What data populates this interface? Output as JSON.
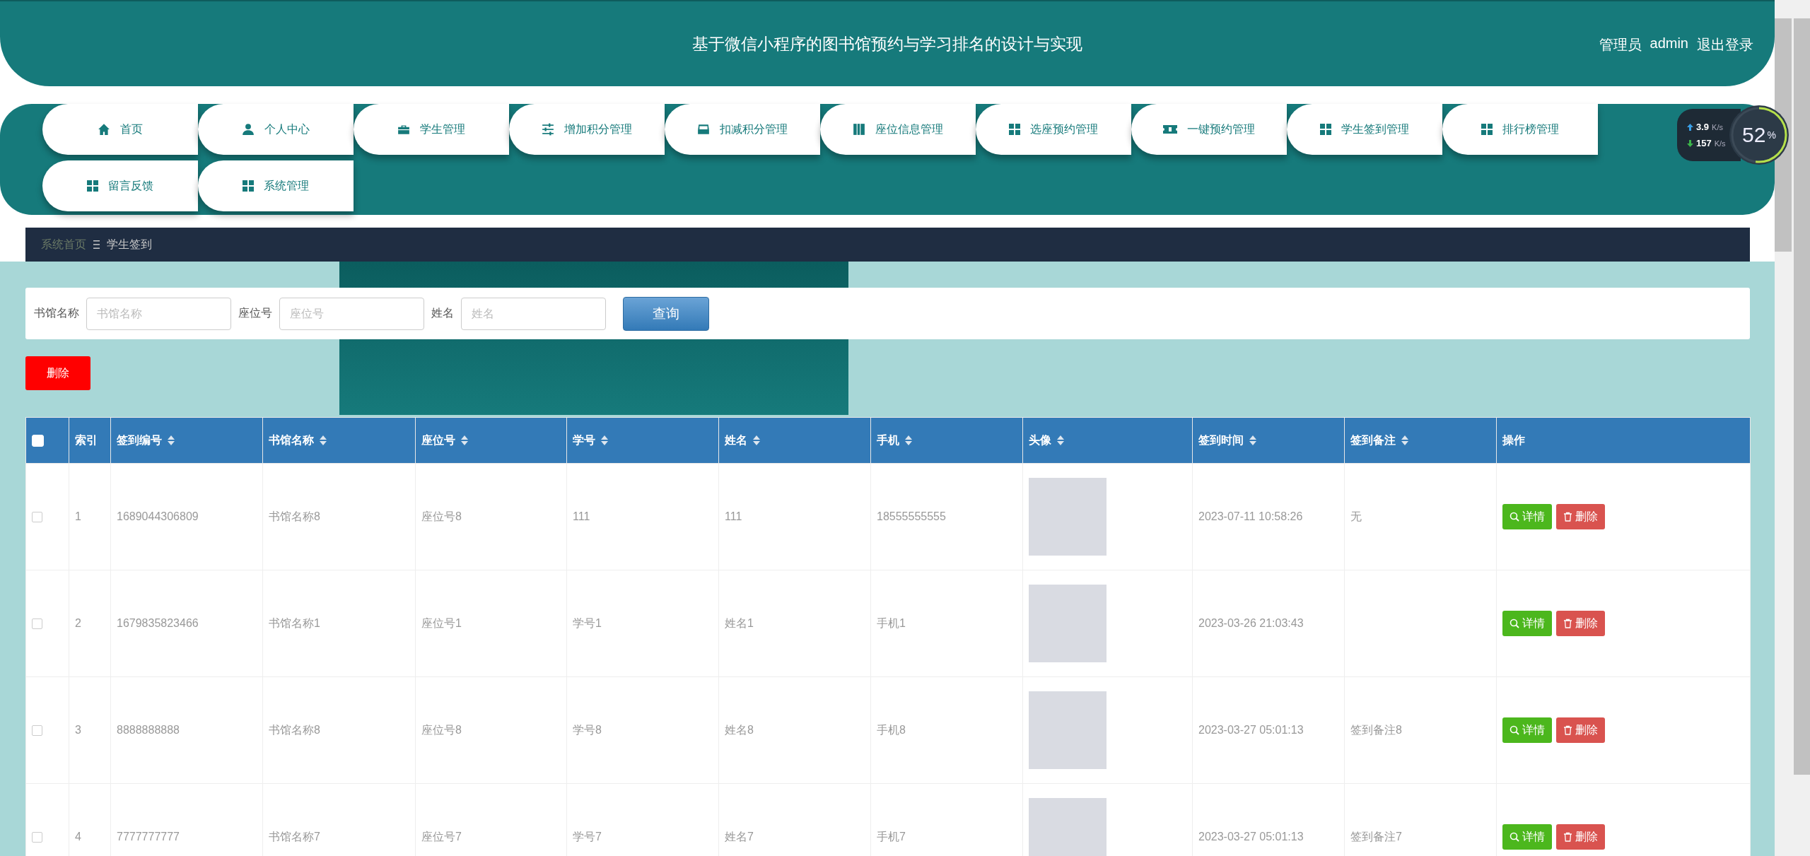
{
  "header": {
    "title": "基于微信小程序的图书馆预约与学习排名的设计与实现",
    "role": "管理员",
    "user": "admin",
    "logout": "退出登录"
  },
  "nav": [
    {
      "label": "首页",
      "kind": "home"
    },
    {
      "label": "个人中心",
      "kind": "user"
    },
    {
      "label": "学生管理",
      "kind": "case"
    },
    {
      "label": "增加积分管理",
      "kind": "sliders"
    },
    {
      "label": "扣减积分管理",
      "kind": "tray"
    },
    {
      "label": "座位信息管理",
      "kind": "book"
    },
    {
      "label": "选座预约管理",
      "kind": "grid"
    },
    {
      "label": "一键预约管理",
      "kind": "ticket"
    },
    {
      "label": "学生签到管理",
      "kind": "grid"
    },
    {
      "label": "排行榜管理",
      "kind": "grid"
    },
    {
      "label": "留言反馈",
      "kind": "grid"
    },
    {
      "label": "系统管理",
      "kind": "grid"
    }
  ],
  "net_widget": {
    "upload": "3.9",
    "upload_unit": "K/s",
    "download": "157",
    "download_unit": "K/s",
    "percent": "52",
    "percent_sign": "%",
    "level": 0.52
  },
  "breadcrumb": {
    "home": "系统首页",
    "current": "学生签到"
  },
  "search": {
    "fields": [
      {
        "label": "书馆名称",
        "placeholder": "书馆名称"
      },
      {
        "label": "座位号",
        "placeholder": "座位号"
      },
      {
        "label": "姓名",
        "placeholder": "姓名"
      }
    ],
    "button": "查询"
  },
  "delete_button": "删除",
  "table": {
    "header_checked": false,
    "columns": [
      {
        "label": "索引",
        "sortable": false
      },
      {
        "label": "签到编号",
        "sortable": true
      },
      {
        "label": "书馆名称",
        "sortable": true
      },
      {
        "label": "座位号",
        "sortable": true
      },
      {
        "label": "学号",
        "sortable": true
      },
      {
        "label": "姓名",
        "sortable": true
      },
      {
        "label": "手机",
        "sortable": true
      },
      {
        "label": "头像",
        "sortable": true
      },
      {
        "label": "签到时间",
        "sortable": true
      },
      {
        "label": "签到备注",
        "sortable": true
      },
      {
        "label": "操作",
        "sortable": false
      }
    ],
    "rows": [
      {
        "checked": false,
        "index": "1",
        "number": "1689044306809",
        "library": "书馆名称8",
        "seat": "座位号8",
        "student_id": "111",
        "name": "111",
        "phone": "18555555555",
        "time": "2023-07-11 10:58:26",
        "note": "无",
        "detail": "详情",
        "delete": "删除"
      },
      {
        "checked": false,
        "index": "2",
        "number": "1679835823466",
        "library": "书馆名称1",
        "seat": "座位号1",
        "student_id": "学号1",
        "name": "姓名1",
        "phone": "手机1",
        "time": "2023-03-26 21:03:43",
        "note": "",
        "detail": "详情",
        "delete": "删除"
      },
      {
        "checked": false,
        "index": "3",
        "number": "8888888888",
        "library": "书馆名称8",
        "seat": "座位号8",
        "student_id": "学号8",
        "name": "姓名8",
        "phone": "手机8",
        "time": "2023-03-27 05:01:13",
        "note": "签到备注8",
        "detail": "详情",
        "delete": "删除"
      },
      {
        "checked": false,
        "index": "4",
        "number": "7777777777",
        "library": "书馆名称7",
        "seat": "座位号7",
        "student_id": "学号7",
        "name": "姓名7",
        "phone": "手机7",
        "time": "2023-03-27 05:01:13",
        "note": "签到备注7",
        "detail": "详情",
        "delete": "删除"
      }
    ]
  }
}
